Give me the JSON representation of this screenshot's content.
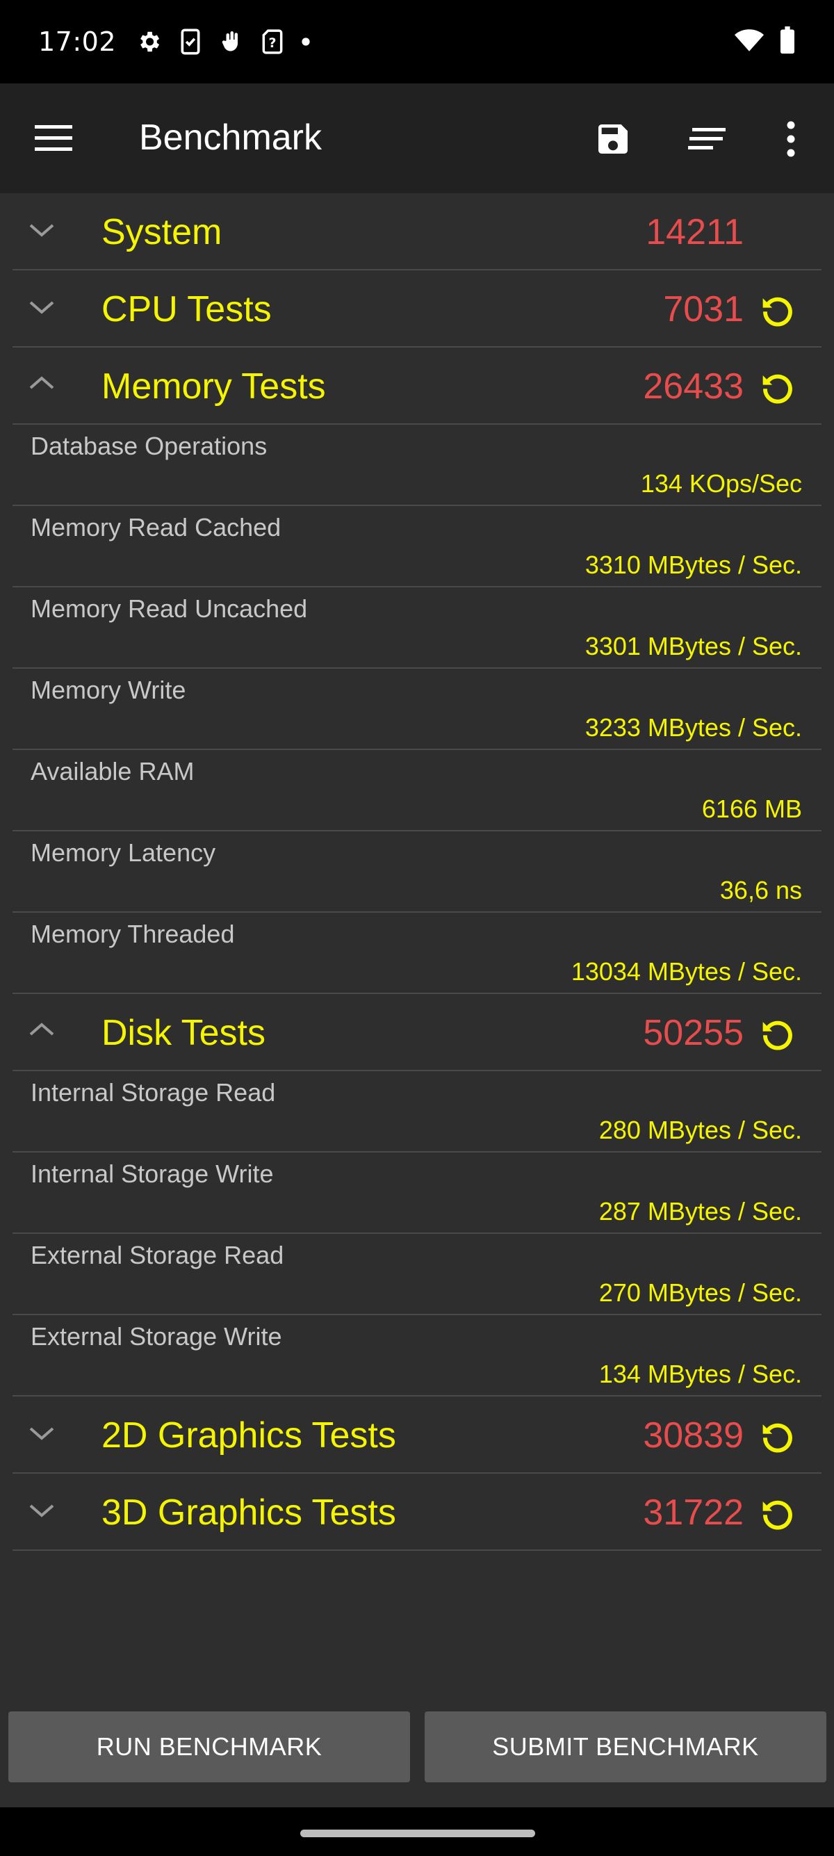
{
  "status_bar": {
    "time": "17:02",
    "icons": [
      "gear-icon",
      "clipboard-check-icon",
      "hand-wave-icon",
      "sim-question-icon",
      "dot-icon"
    ],
    "right_icons": [
      "wifi-icon",
      "battery-icon"
    ]
  },
  "app_bar": {
    "title": "Benchmark",
    "icons": [
      "menu-icon",
      "save-icon",
      "sort-icon",
      "more-vert-icon"
    ]
  },
  "sections": {
    "system": {
      "name": "System",
      "score": "14211",
      "expanded": false
    },
    "cpu": {
      "name": "CPU Tests",
      "score": "7031",
      "expanded": false
    },
    "memory": {
      "name": "Memory Tests",
      "score": "26433",
      "expanded": true,
      "rows": [
        {
          "label": "Database Operations",
          "value": "134 KOps/Sec"
        },
        {
          "label": "Memory Read Cached",
          "value": "3310 MBytes / Sec."
        },
        {
          "label": "Memory Read Uncached",
          "value": "3301 MBytes / Sec."
        },
        {
          "label": "Memory Write",
          "value": "3233 MBytes / Sec."
        },
        {
          "label": "Available RAM",
          "value": "6166 MB"
        },
        {
          "label": "Memory Latency",
          "value": "36,6 ns"
        },
        {
          "label": "Memory Threaded",
          "value": "13034 MBytes / Sec."
        }
      ]
    },
    "disk": {
      "name": "Disk Tests",
      "score": "50255",
      "expanded": true,
      "rows": [
        {
          "label": "Internal Storage Read",
          "value": "280 MBytes / Sec."
        },
        {
          "label": "Internal Storage Write",
          "value": "287 MBytes / Sec."
        },
        {
          "label": "External Storage Read",
          "value": "270 MBytes / Sec."
        },
        {
          "label": "External Storage Write",
          "value": "134 MBytes / Sec."
        }
      ]
    },
    "graphics2d": {
      "name": "2D Graphics Tests",
      "score": "30839",
      "expanded": false
    },
    "graphics3d": {
      "name": "3D Graphics Tests",
      "score": "31722",
      "expanded": false
    }
  },
  "buttons": {
    "run": "RUN BENCHMARK",
    "submit": "SUBMIT BENCHMARK"
  },
  "colors": {
    "section_name": "#f5f500",
    "score": "#e94c4c",
    "value": "#f5f500",
    "label": "#c8c8c8",
    "refresh_icon": "#f5f500"
  }
}
